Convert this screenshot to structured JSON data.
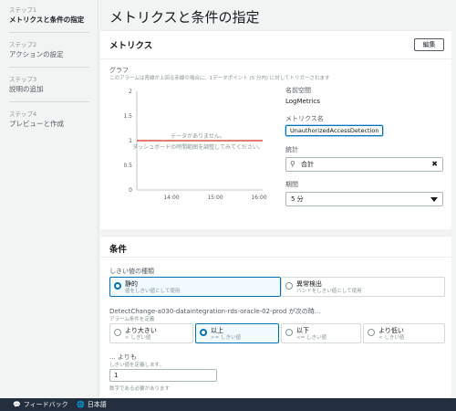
{
  "sidebar": {
    "steps": [
      {
        "num": "ステップ1",
        "name": "メトリクスと条件の指定"
      },
      {
        "num": "ステップ2",
        "name": "アクションの設定"
      },
      {
        "num": "ステップ3",
        "name": "説明の追加"
      },
      {
        "num": "ステップ4",
        "name": "プレビューと作成"
      }
    ]
  },
  "page": {
    "title": "メトリクスと条件の指定"
  },
  "metrics": {
    "title": "メトリクス",
    "edit_label": "編集",
    "graph_label": "グラフ",
    "graph_desc": "このアラームは青線が上回る赤線の場合に、1データポイント (5 分内) に対してトリガーされます",
    "no_data": "データがありません。",
    "no_data_hint": "ダッシュボードの時間範囲を調整してみてください。",
    "namespace_label": "名前空間",
    "namespace_value": "LogMetrics",
    "metric_name_label": "メトリクス名",
    "metric_name_value": "UnauthorizedAccessDetection",
    "stat_label": "統計",
    "stat_value": "合計",
    "period_label": "期間",
    "period_value": "5 分"
  },
  "chart_data": {
    "type": "line",
    "x_ticks": [
      "14:00",
      "15:00",
      "16:00"
    ],
    "y_ticks": [
      "2",
      "1.5",
      "1",
      "0.5",
      "0"
    ],
    "ylim": [
      0,
      2
    ],
    "threshold": 1,
    "threshold_color": "#d13212",
    "series": []
  },
  "conditions": {
    "title": "条件",
    "threshold_type_label": "しきい値の種類",
    "threshold_types": [
      {
        "label": "静的",
        "desc": "値をしきい値として使用",
        "selected": true
      },
      {
        "label": "異常検出",
        "desc": "バンドをしきい値として使用",
        "selected": false
      }
    ],
    "alarm_condition_label": "DetectChange-a030-dataintegration-rds-oracle-02-prod が次の時...",
    "alarm_condition_desc": "アラーム条件を定義",
    "operators": [
      {
        "label": "より大きい",
        "desc": "> しきい値",
        "selected": false
      },
      {
        "label": "以上",
        "desc": ">= しきい値",
        "selected": true
      },
      {
        "label": "以下",
        "desc": "<= しきい値",
        "selected": false
      },
      {
        "label": "より低い",
        "desc": "< しきい値",
        "selected": false
      }
    ],
    "threshold_label": "... よりも",
    "threshold_desc": "しきい値を定義します。",
    "threshold_value": "1",
    "threshold_hint": "数字である必要があります"
  },
  "footer": {
    "feedback_label": "フィードバック",
    "language_label": "日本語"
  },
  "colors": {
    "accent": "#0073bb",
    "threshold": "#d13212",
    "footer_bg": "#232f3e"
  }
}
